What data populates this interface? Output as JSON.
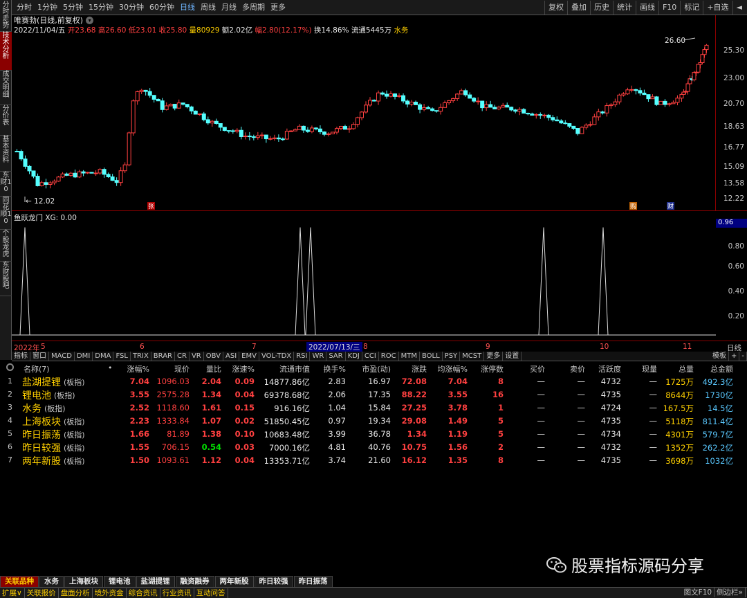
{
  "toolbar": {
    "periods": [
      "分时",
      "1分钟",
      "5分钟",
      "15分钟",
      "30分钟",
      "60分钟",
      "日线",
      "周线",
      "月线",
      "多周期",
      "更多"
    ],
    "active_period": "日线",
    "right_tools": [
      "复权",
      "叠加",
      "历史",
      "统计",
      "画线",
      "F10",
      "标记",
      "+自选",
      "◄"
    ]
  },
  "left_tabs": [
    "分时走势",
    "技术分析",
    "成交明细",
    "分价表",
    "基本资料",
    "东财10",
    "同花顺10",
    "个股龙虎",
    "东财股吧"
  ],
  "active_left_tab": "技术分析",
  "title": {
    "name": "唯赛勃(日线,前复权)",
    "dropdown_icon": "chevron-down-icon"
  },
  "ohlc": {
    "date": "2022/11/04/五",
    "open_label": "开",
    "open": "23.68",
    "high_label": "高",
    "high": "26.60",
    "low_label": "低",
    "low": "23.01",
    "close_label": "收",
    "close": "25.80",
    "vol_label": "量",
    "vol": "80929",
    "amt_label": "额",
    "amt": "2.02亿",
    "chg_label": "幅",
    "chg": "2.80(12.17%)",
    "turnover_label": "换",
    "turnover": "14.86%",
    "float_label": "流通",
    "float": "5445万",
    "concept": "水务"
  },
  "main_yaxis": [
    "25.30",
    "23.00",
    "20.70",
    "18.63",
    "16.77",
    "15.09",
    "13.58",
    "12.22"
  ],
  "annotations": {
    "high": "26.60",
    "low": "12.02",
    "marker_zhang": "张",
    "marker_gou": "购",
    "marker_cai": "财"
  },
  "indicator": {
    "title": "鱼跃龙门 XG: 0.00",
    "current": "0.96",
    "yaxis": [
      "0.80",
      "0.60",
      "0.40",
      "0.20"
    ]
  },
  "xaxis": {
    "ticks": [
      "2022年",
      "5",
      "6",
      "7",
      "8",
      "9",
      "10",
      "11"
    ],
    "highlight": "2022/07/13/三",
    "right_label": "日线"
  },
  "indicator_tabs": [
    "指标",
    "窗口",
    "MACD",
    "DMI",
    "DMA",
    "FSL",
    "TRIX",
    "BRAR",
    "CR",
    "VR",
    "OBV",
    "ASI",
    "EMV",
    "VOL-TDX",
    "RSI",
    "WR",
    "SAR",
    "KDJ",
    "CCI",
    "ROC",
    "MTM",
    "BOLL",
    "PSY",
    "MCST",
    "更多",
    "设置"
  ],
  "indicator_tabs_right": [
    "模板",
    "+",
    "-"
  ],
  "table": {
    "headers": [
      "名称(7)",
      "",
      "涨幅%",
      "现价",
      "量比",
      "涨速%",
      "流通市值",
      "换手%",
      "市盈(动)",
      "涨跌",
      "均涨幅%",
      "涨停数",
      "买价",
      "卖价",
      "活跃度",
      "现量",
      "总量",
      "总金额"
    ],
    "rows": [
      [
        "1",
        "盐湖提锂",
        "(板指)",
        "7.04",
        "1096.03",
        "2.04",
        "0.09",
        "14877.86亿",
        "2.83",
        "16.97",
        "72.08",
        "7.04",
        "8",
        "—",
        "—",
        "4732",
        "—",
        "1725万",
        "492.3亿"
      ],
      [
        "2",
        "锂电池",
        "(板指)",
        "3.55",
        "2575.28",
        "1.34",
        "0.04",
        "69378.68亿",
        "2.06",
        "17.35",
        "88.22",
        "3.55",
        "16",
        "—",
        "—",
        "4735",
        "—",
        "8644万",
        "1730亿"
      ],
      [
        "3",
        "水务",
        "(板指)",
        "2.52",
        "1118.60",
        "1.61",
        "0.15",
        "916.16亿",
        "1.04",
        "15.84",
        "27.25",
        "3.78",
        "1",
        "—",
        "—",
        "4724",
        "—",
        "167.5万",
        "14.5亿"
      ],
      [
        "4",
        "上海板块",
        "(板指)",
        "2.23",
        "1333.84",
        "1.07",
        "0.02",
        "51850.45亿",
        "0.97",
        "19.34",
        "29.08",
        "1.49",
        "5",
        "—",
        "—",
        "4735",
        "—",
        "5118万",
        "811.4亿"
      ],
      [
        "5",
        "昨日振荡",
        "(板指)",
        "1.66",
        "81.89",
        "1.38",
        "0.10",
        "10683.48亿",
        "3.99",
        "36.78",
        "1.34",
        "1.19",
        "5",
        "—",
        "—",
        "4734",
        "—",
        "4301万",
        "579.7亿"
      ],
      [
        "6",
        "昨日较强",
        "(板指)",
        "1.55",
        "706.15",
        "0.54",
        "0.03",
        "7000.16亿",
        "4.81",
        "40.76",
        "10.75",
        "1.56",
        "2",
        "—",
        "—",
        "4732",
        "—",
        "1352万",
        "262.2亿"
      ],
      [
        "7",
        "两年新股",
        "(板指)",
        "1.50",
        "1093.61",
        "1.12",
        "0.04",
        "13353.71亿",
        "3.74",
        "21.60",
        "16.12",
        "1.35",
        "8",
        "—",
        "—",
        "4735",
        "—",
        "3698万",
        "1032亿"
      ]
    ]
  },
  "footer_brand": "股票指标源码分享",
  "sector_tabs": [
    "关联品种",
    "水务",
    "上海板块",
    "锂电池",
    "盐湖提锂",
    "融资融券",
    "两年新股",
    "昨日较强",
    "昨日振荡"
  ],
  "status_bar": {
    "left": [
      "扩展∨",
      "关联报价",
      "盘面分析",
      "境外资金",
      "综合资讯",
      "行业资讯",
      "互动问答"
    ],
    "right": [
      "图文F10",
      "侧边栏»"
    ]
  },
  "colors": {
    "up": "#ff4040",
    "down": "#54ffff",
    "border": "#8a0000",
    "flat": "#ffd000"
  }
}
